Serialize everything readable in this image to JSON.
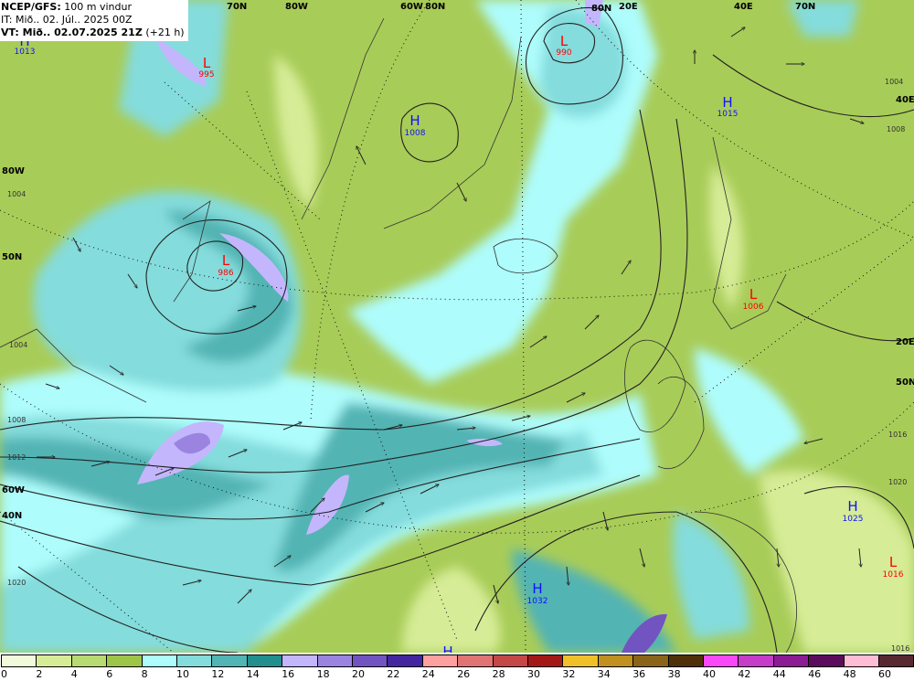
{
  "header": {
    "model_label": "NCEP/GFS:",
    "field": "100 m vindur",
    "init_time": "IT: Mið.. 02. Júl.. 2025 00Z",
    "valid_label": "VT: Mið.. 02.07.2025 21Z",
    "forecast_hour": "(+21 h)"
  },
  "pressure_centers": [
    {
      "type": "L",
      "value": "995"
    },
    {
      "type": "L",
      "value": "990"
    },
    {
      "type": "H",
      "value": "1008"
    },
    {
      "type": "H",
      "value": "1015"
    },
    {
      "type": "H",
      "value": "1013"
    },
    {
      "type": "L",
      "value": "986"
    },
    {
      "type": "L",
      "value": "1006"
    },
    {
      "type": "H",
      "value": "1025"
    },
    {
      "type": "L",
      "value": "1016"
    },
    {
      "type": "H",
      "value": "1032"
    },
    {
      "type": "H",
      "value": ""
    }
  ],
  "grid_labels": [
    "70N",
    "80W",
    "60W",
    "80N",
    "80N",
    "20E",
    "40E",
    "70N",
    "40E",
    "80W",
    "50N",
    "20E",
    "50N",
    "60W",
    "40N"
  ],
  "isobar_labels": [
    "1004",
    "1004",
    "1008",
    "1012",
    "1004",
    "1008",
    "1016",
    "1020",
    "1016",
    "1020"
  ],
  "colors": {
    "low": "#ff0000",
    "high": "#1010ff"
  },
  "colorbar": {
    "unit_hint": "m/s",
    "ticks": [
      "0",
      "2",
      "4",
      "6",
      "8",
      "10",
      "12",
      "14",
      "16",
      "18",
      "20",
      "22",
      "24",
      "26",
      "28",
      "30",
      "32",
      "34",
      "36",
      "38",
      "40",
      "42",
      "44",
      "46",
      "48",
      "60"
    ],
    "colors": [
      "#f2fadc",
      "#d6ec96",
      "#b8da72",
      "#9dc548",
      "#aefcfc",
      "#84dcdc",
      "#52b4b4",
      "#228e8e",
      "#c4b6fc",
      "#9a84e0",
      "#7254c0",
      "#4426a0",
      "#ffa0a0",
      "#e07474",
      "#c44848",
      "#a41818",
      "#f0c028",
      "#c09020",
      "#8a6418",
      "#503008",
      "#f848f8",
      "#c43cc8",
      "#8c1c94",
      "#5c0c5c",
      "#ffbcd4",
      "#582830"
    ]
  }
}
